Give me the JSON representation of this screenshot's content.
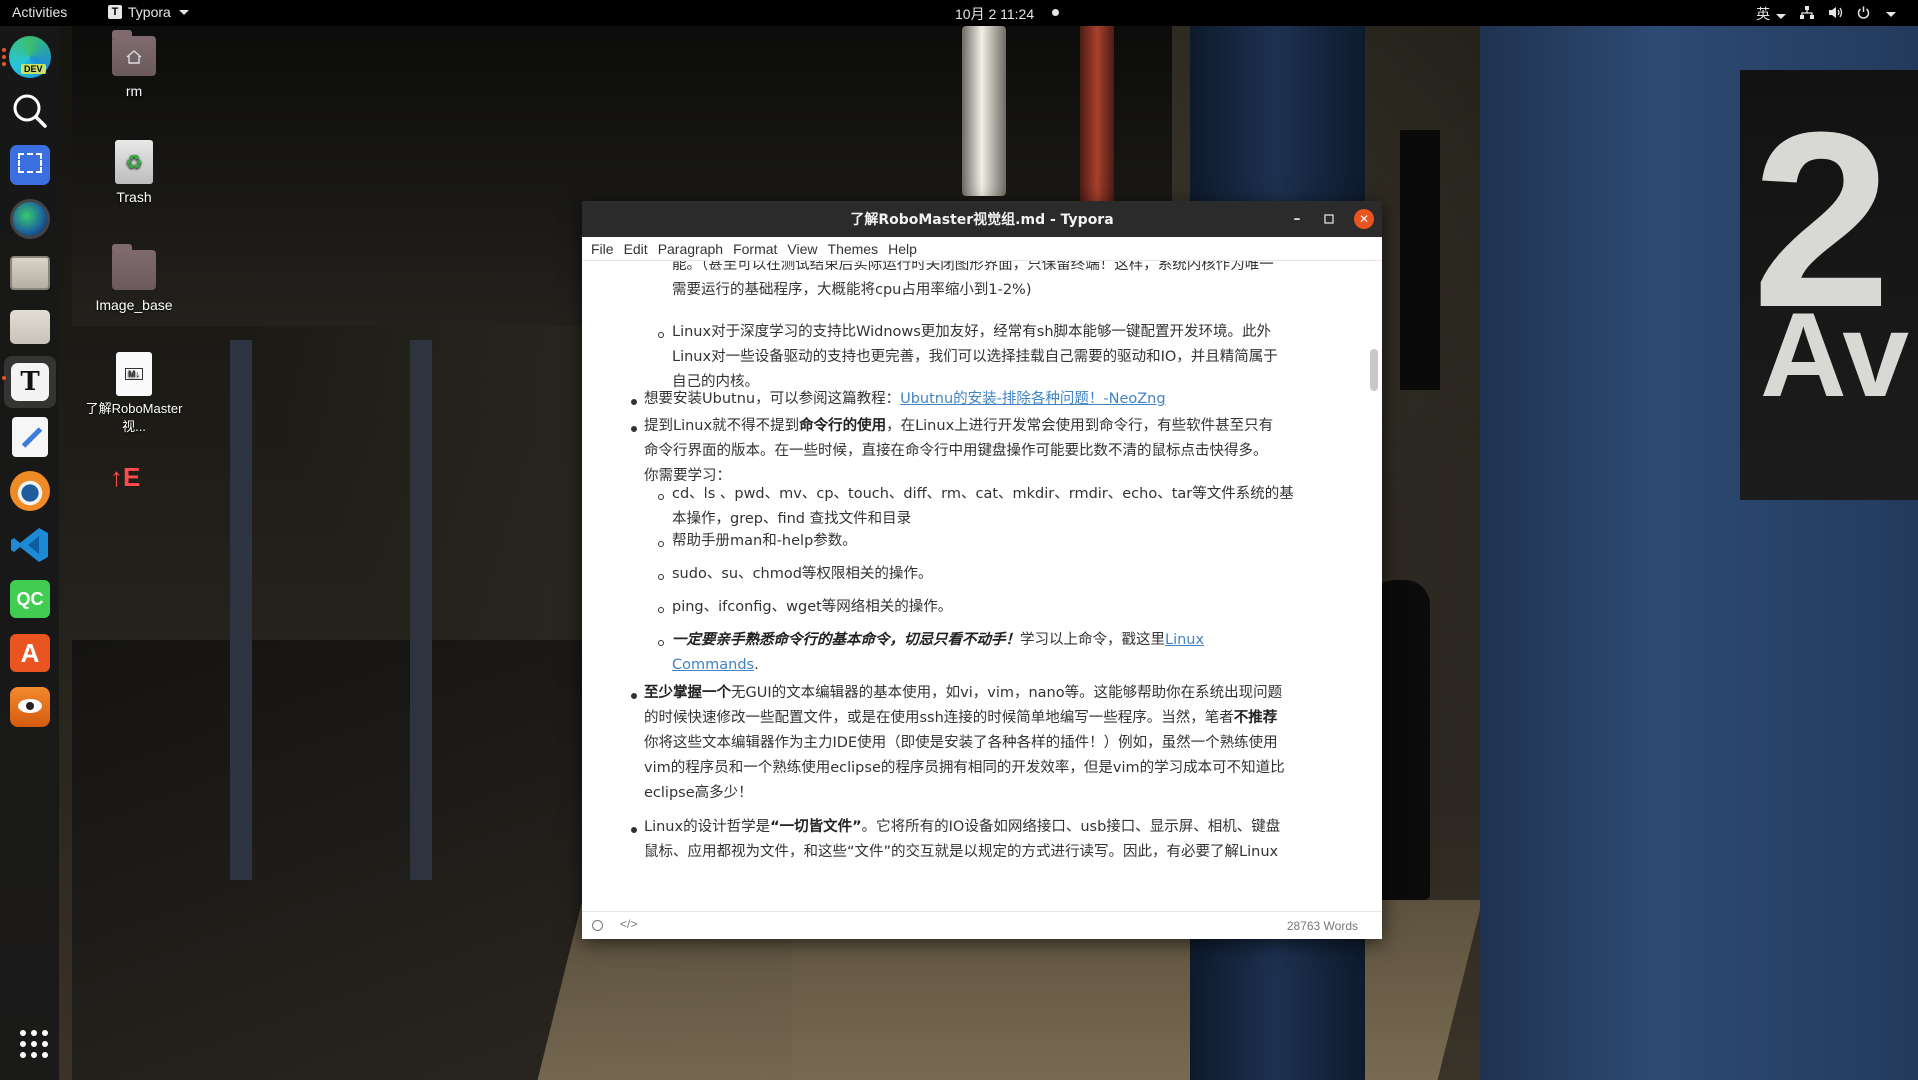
{
  "topbar": {
    "activities": "Activities",
    "app_name": "Typora",
    "clock": "10月 2  11:24",
    "input_method": "英"
  },
  "desktop": {
    "icons": [
      {
        "label": "rm"
      },
      {
        "label": "Trash"
      },
      {
        "label": "Image_base"
      },
      {
        "label": "了解RoboMaster视..."
      }
    ],
    "doc_badge": "M↓"
  },
  "dock": {
    "apps": [
      "edge-dev",
      "search",
      "screenshot",
      "browser",
      "file-manager",
      "files",
      "typora",
      "text-editor",
      "blender",
      "vscode",
      "qt-creator",
      "software-center",
      "anki"
    ],
    "dev_badge": "DEV",
    "qc_label": "QC"
  },
  "wallpaper": {
    "sign_number": "2",
    "sign_text": "Av",
    "exit_sign": "↑E"
  },
  "window": {
    "title": "了解RoboMaster视觉组.md - Typora",
    "menu": [
      "File",
      "Edit",
      "Paragraph",
      "Format",
      "View",
      "Themes",
      "Help"
    ],
    "status_words": "28763 Words"
  },
  "doc": {
    "p0_line1": "能。（甚至可以在测试结束后实际运行时关闭图形界面，只保留终端！这样，系统内核作为唯一",
    "p0_line2": "需要运行的基础程序，大概能将cpu占用率缩小到1-2%)",
    "p1_line1": "Linux对于深度学习的支持比Widnows更加友好，经常有sh脚本能够一键配置开发环境。此外",
    "p1_line2": "Linux对一些设备驱动的支持也更完善，我们可以选择挂载自己需要的驱动和IO，并且精简属于",
    "p1_line3": "自己的内核。",
    "p2_text": "想要安装Ubutnu，可以参阅这篇教程：",
    "p2_link": "Ubutnu的安装-排除各种问题！-NeoZng",
    "p3_pre": "提到Linux就不得不提到",
    "p3_bold": "命令行的使用",
    "p3_post": "，在Linux上进行开发常会使用到命令行，有些软件甚至只有",
    "p3_line2": "命令行界面的版本。在一些时候，直接在命令行中用键盘操作可能要比数不清的鼠标点击快得多。",
    "p3_line3": "你需要学习：",
    "s1_line1": "cd、ls 、pwd、mv、cp、touch、diff、rm、cat、mkdir、rmdir、echo、tar等文件系统的基",
    "s1_line2": "本操作，grep、find 查找文件和目录",
    "s2": "帮助手册man和-help参数。",
    "s3": "sudo、su、chmod等权限相关的操作。",
    "s4": "ping、ifconfig、wget等网络相关的操作。",
    "s5_bi": "一定要亲手熟悉命令行的基本命令，切忌只看不动手！",
    "s5_text": "学习以上命令，戳这里",
    "s5_link1": "Linux",
    "s5_link2": "Commands",
    "s5_end": ".",
    "p4_bold": "至少掌握一个",
    "p4_post": "无GUI的文本编辑器的基本使用，如vi，vim，nano等。这能够帮助你在系统出现问题",
    "p4_line2_pre": "的时候快速修改一些配置文件，或是在使用ssh连接的时候简单地编写一些程序。当然，笔者",
    "p4_line2_bold": "不推荐",
    "p4_line3": "你将这些文本编辑器作为主力IDE使用（即使是安装了各种各样的插件！）例如，虽然一个熟练使用",
    "p4_line4": "vim的程序员和一个熟练使用eclipse的程序员拥有相同的开发效率，但是vim的学习成本可不知道比",
    "p4_line5": "eclipse高多少！",
    "p5_pre": "Linux的设计哲学是",
    "p5_bold": "“一切皆文件”",
    "p5_post": "。它将所有的IO设备如网络接口、usb接口、显示屏、相机、键盘",
    "p5_line2": "鼠标、应用都视为文件，和这些“文件”的交互就是以规定的方式进行读写。因此，有必要了解Linux"
  }
}
